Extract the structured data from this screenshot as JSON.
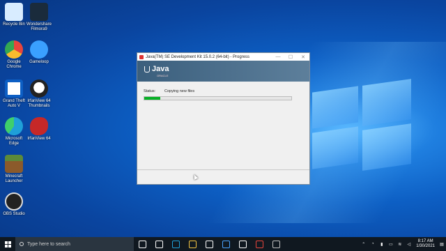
{
  "desktop": {
    "icons": [
      {
        "label": "Recycle Bin",
        "icon": "recycle-bin-icon",
        "color": "#cfe8ff"
      },
      {
        "label": "Wondershare Filmora9",
        "icon": "filmora-icon",
        "color": "#1a2b3c"
      },
      {
        "label": "Google Chrome",
        "icon": "chrome-icon",
        "color": "#e8453c"
      },
      {
        "label": "Gameloop",
        "icon": "gameloop-icon",
        "color": "#3aa0ff"
      },
      {
        "label": "Grand Theft Auto V",
        "icon": "gta-icon",
        "color": "#ffffff"
      },
      {
        "label": "IrfanView 64 Thumbnails",
        "icon": "irfanview-thumbnails-icon",
        "color": "#2b2b2b"
      },
      {
        "label": "Microsoft Edge",
        "icon": "edge-icon",
        "color": "#1fa0d8"
      },
      {
        "label": "IrfanView 64",
        "icon": "irfanview-icon",
        "color": "#c62828"
      },
      {
        "label": "Minecraft Launcher",
        "icon": "minecraft-icon",
        "color": "#5c8a3a"
      },
      {
        "label": "OBS Studio",
        "icon": "obs-icon",
        "color": "#222222"
      }
    ]
  },
  "window": {
    "title": "Java(TM) SE Development Kit 15.0.2 (64-bit) - Progress",
    "minimize": "—",
    "maximize": "☐",
    "close": "✕",
    "banner": {
      "brand": "Java",
      "sub": "ORACLE"
    },
    "status_label": "Status:",
    "status_value": "Copying new files",
    "progress": 0.11
  },
  "taskbar": {
    "search_placeholder": "Type here to search",
    "apps": [
      {
        "icon": "task-view-icon",
        "color": "#ffffff"
      },
      {
        "icon": "timeline-icon",
        "color": "#ffffff"
      },
      {
        "icon": "edge-icon",
        "color": "#1fa0d8"
      },
      {
        "icon": "file-explorer-icon",
        "color": "#f5c542"
      },
      {
        "icon": "store-icon",
        "color": "#ffffff"
      },
      {
        "icon": "mail-icon",
        "color": "#4aa3ff"
      },
      {
        "icon": "settings-icon",
        "color": "#ffffff"
      },
      {
        "icon": "chrome-icon",
        "color": "#e8453c"
      },
      {
        "icon": "java-installer-icon",
        "color": "#c0c0c0"
      }
    ],
    "time": "8:17 AM",
    "date": "1/30/2021"
  }
}
